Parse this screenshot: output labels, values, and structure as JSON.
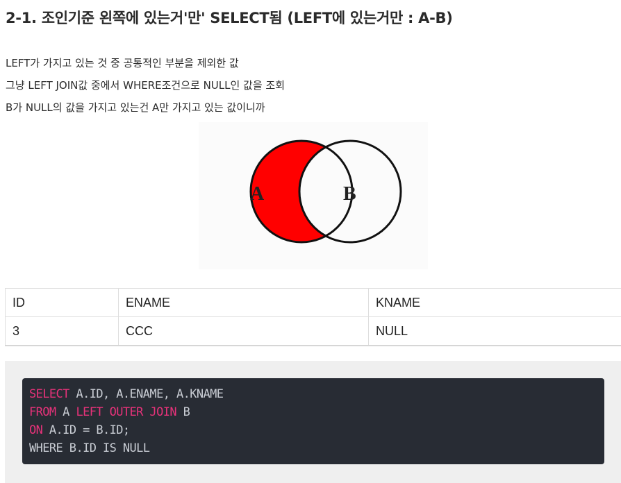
{
  "heading": "2-1. 조인기준 왼쪽에 있는거'만' SELECT됨 (LEFT에 있는거만 : A-B)",
  "paragraphs": [
    "LEFT가 가지고 있는 것 중 공통적인 부분을 제외한 값",
    "그냥 LEFT JOIN값 중에서 WHERE조건으로 NULL인 값을 조회",
    "B가 NULL의 값을 가지고 있는건 A만 가지고 있는 값이니까"
  ],
  "venn": {
    "label_a": "A",
    "label_b": "B",
    "fill_color": "#ff0000"
  },
  "table": {
    "headers": [
      "ID",
      "ENAME",
      "KNAME"
    ],
    "rows": [
      [
        "3",
        "CCC",
        "NULL"
      ]
    ]
  },
  "code": {
    "line1": {
      "kw": "SELECT",
      "rest": " A.ID, A.ENAME, A.KNAME"
    },
    "line2": {
      "kw1": "FROM",
      "mid": " A ",
      "kw2": "LEFT OUTER JOIN",
      "rest": " B"
    },
    "line3": {
      "kw": "ON",
      "rest": " A.ID = B.ID;"
    },
    "line4": {
      "rest": "WHERE B.ID IS NULL"
    },
    "keyword_color": "#e8327a",
    "background": "#282c34"
  }
}
